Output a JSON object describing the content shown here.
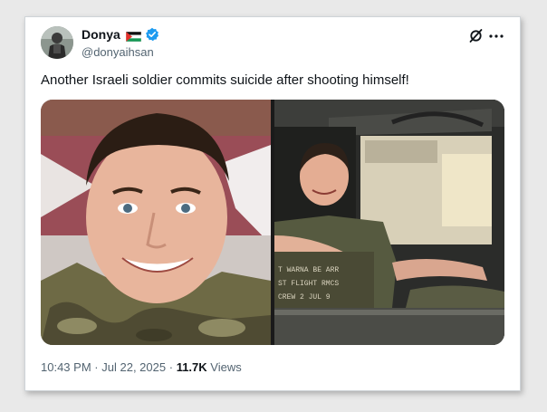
{
  "post": {
    "author_name": "Donya",
    "handle": "@donyaihsan",
    "text": "Another Israeli soldier commits suicide after shooting himself!",
    "time": "10:43 PM",
    "separator": "·",
    "date": "Jul 22, 2025",
    "views_count": "11.7K",
    "views_label": "Views"
  },
  "photo_right_text": {
    "line1": "T WARNA BE ARR",
    "line2": "ST FLIGHT  RMCS",
    "line3": "CREW    2 JUL 9"
  },
  "icons": {
    "flag": "palestine-flag-icon",
    "verified": "verified-badge-icon",
    "grok": "grok-icon",
    "more": "more-options-icon"
  },
  "colors": {
    "verified_blue": "#1d9bf0",
    "text_primary": "#0f1419",
    "text_secondary": "#536471"
  }
}
